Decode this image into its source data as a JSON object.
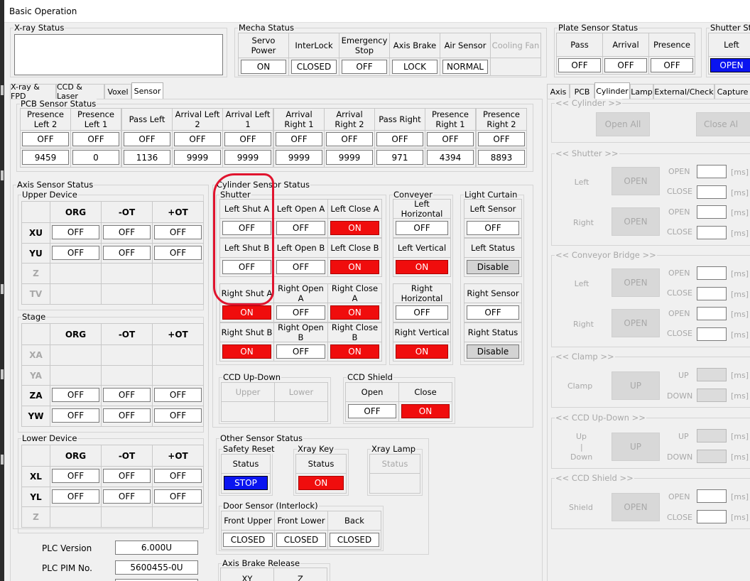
{
  "window": {
    "title": "Basic Operation"
  },
  "xray": {
    "legend": "X-ray Status"
  },
  "mecha": {
    "legend": "Mecha Status",
    "headers": [
      "Servo Power",
      "InterLock",
      "Emergency Stop",
      "Axis Brake",
      "Air Sensor",
      "Cooling Fan"
    ],
    "values": [
      "ON",
      "CLOSED",
      "OFF",
      "LOCK",
      "NORMAL",
      ""
    ]
  },
  "plate": {
    "legend": "Plate Sensor Status",
    "headers": [
      "Pass",
      "Arrival",
      "Presence"
    ],
    "values": [
      "OFF",
      "OFF",
      "OFF"
    ]
  },
  "shutter_status": {
    "legend": "Shutter Sta",
    "headers": [
      "Left"
    ],
    "values": [
      "OPEN"
    ]
  },
  "left_tabs": [
    "X-ray & FPD",
    "CCD & Laser",
    "Voxel",
    "Sensor"
  ],
  "right_tabs": [
    "Axis",
    "PCB",
    "Cylinder",
    "Lamp",
    "External/Check",
    "Capture"
  ],
  "pcb": {
    "legend": "PCB Sensor Status",
    "headers": [
      "Presence Left 2",
      "Presence Left 1",
      "Pass Left",
      "Arrival Left 2",
      "Arrival Left 1",
      "Arrival Right 1",
      "Arrival Right 2",
      "Pass Right",
      "Presence Right 1",
      "Presence Right 2"
    ],
    "states": [
      "OFF",
      "OFF",
      "OFF",
      "OFF",
      "OFF",
      "OFF",
      "OFF",
      "OFF",
      "OFF",
      "OFF"
    ],
    "counts": [
      "9459",
      "0",
      "1136",
      "9999",
      "9999",
      "9999",
      "9999",
      "971",
      "4394",
      "8893"
    ]
  },
  "axis": {
    "legend": "Axis Sensor Status",
    "upper": {
      "legend": "Upper Device",
      "cols": [
        "ORG",
        "-OT",
        "+OT"
      ],
      "rows": [
        {
          "name": "XU",
          "vals": [
            "OFF",
            "OFF",
            "OFF"
          ]
        },
        {
          "name": "YU",
          "vals": [
            "OFF",
            "OFF",
            "OFF"
          ]
        },
        {
          "name": "Z",
          "vals": [
            "",
            "",
            ""
          ]
        },
        {
          "name": "TV",
          "vals": [
            "",
            "",
            ""
          ]
        }
      ]
    },
    "stage": {
      "legend": "Stage",
      "cols": [
        "ORG",
        "-OT",
        "+OT"
      ],
      "rows": [
        {
          "name": "XA",
          "vals": [
            "",
            "",
            ""
          ]
        },
        {
          "name": "YA",
          "vals": [
            "",
            "",
            ""
          ]
        },
        {
          "name": "ZA",
          "vals": [
            "OFF",
            "OFF",
            "OFF"
          ]
        },
        {
          "name": "YW",
          "vals": [
            "OFF",
            "OFF",
            "OFF"
          ]
        }
      ]
    },
    "lower": {
      "legend": "Lower Device",
      "cols": [
        "ORG",
        "-OT",
        "+OT"
      ],
      "rows": [
        {
          "name": "XL",
          "vals": [
            "OFF",
            "OFF",
            "OFF"
          ]
        },
        {
          "name": "YL",
          "vals": [
            "OFF",
            "OFF",
            "OFF"
          ]
        },
        {
          "name": "Z",
          "vals": [
            "",
            "",
            ""
          ]
        }
      ]
    }
  },
  "cyl": {
    "legend": "Cylinder Sensor Status",
    "shutter": {
      "legend": "Shutter",
      "labels": [
        "Left Shut A",
        "Left Open A",
        "Left Close A",
        "Left Shut B",
        "Left Open B",
        "Left Close B",
        "Right Shut A",
        "Right Open A",
        "Right Close A",
        "Right Shut B",
        "Right Open B",
        "Right Close B"
      ],
      "values": [
        "OFF",
        "OFF",
        "ON",
        "OFF",
        "OFF",
        "ON",
        "ON",
        "OFF",
        "ON",
        "ON",
        "OFF",
        "ON"
      ]
    },
    "conveyer": {
      "legend": "Conveyer",
      "labels": [
        "Left Horizontal",
        "Left Vertical",
        "Right Horizontal",
        "Right Vertical"
      ],
      "values": [
        "OFF",
        "ON",
        "OFF",
        "ON"
      ]
    },
    "curtain": {
      "legend": "Light Curtain",
      "labels": [
        "Left Sensor",
        "Left Status",
        "Right Sensor",
        "Right Status"
      ],
      "values": [
        "OFF",
        "Disable",
        "OFF",
        "Disable"
      ]
    },
    "ccd_updown": {
      "legend": "CCD Up-Down",
      "labels": [
        "Upper",
        "Lower"
      ]
    },
    "ccd_shield": {
      "legend": "CCD Shield",
      "labels": [
        "Open",
        "Close"
      ],
      "values": [
        "OFF",
        "ON"
      ]
    }
  },
  "other": {
    "legend": "Other Sensor Status",
    "safety": {
      "legend": "Safety Reset",
      "label": "Status",
      "value": "STOP"
    },
    "xraykey": {
      "legend": "Xray Key",
      "label": "Status",
      "value": "ON"
    },
    "xraylamp": {
      "legend": "Xray Lamp",
      "label": "Status"
    },
    "door": {
      "legend": "Door Sensor (Interlock)",
      "labels": [
        "Front Upper",
        "Front Lower",
        "Back"
      ],
      "values": [
        "CLOSED",
        "CLOSED",
        "CLOSED"
      ]
    }
  },
  "brake": {
    "legend": "Axis Brake Release",
    "labels": [
      "XY",
      "Z"
    ]
  },
  "plc": {
    "version_label": "PLC Version",
    "version": "6.000U",
    "pim_label": "PLC PIM No.",
    "pim": "5600455-0U"
  },
  "cylinder_panel": {
    "cylinder": {
      "legend": "<< Cylinder >>",
      "open_all": "Open All",
      "close_all": "Close Al"
    },
    "shutter": {
      "legend": "<< Shutter >>",
      "rows": [
        {
          "label": "Left",
          "btn": "OPEN"
        },
        {
          "label": "Right",
          "btn": "OPEN"
        }
      ]
    },
    "conveyor": {
      "legend": "<< Conveyor Bridge >>",
      "rows": [
        {
          "label": "Left",
          "btn": "OPEN"
        },
        {
          "label": "Right",
          "btn": "OPEN"
        }
      ]
    },
    "clamp": {
      "legend": "<< Clamp >>",
      "label": "Clamp",
      "btn": "UP"
    },
    "ccd_updown": {
      "legend": "<< CCD Up-Down >>",
      "label_up": "Up",
      "label_sep": "|",
      "label_down": "Down",
      "btn": "UP"
    },
    "ccd_shield": {
      "legend": "<< CCD Shield >>",
      "label": "Shield",
      "btn": "OPEN"
    },
    "open": "OPEN",
    "close": "CLOSE",
    "up": "UP",
    "down": "DOWN",
    "ms": "[ms]"
  }
}
